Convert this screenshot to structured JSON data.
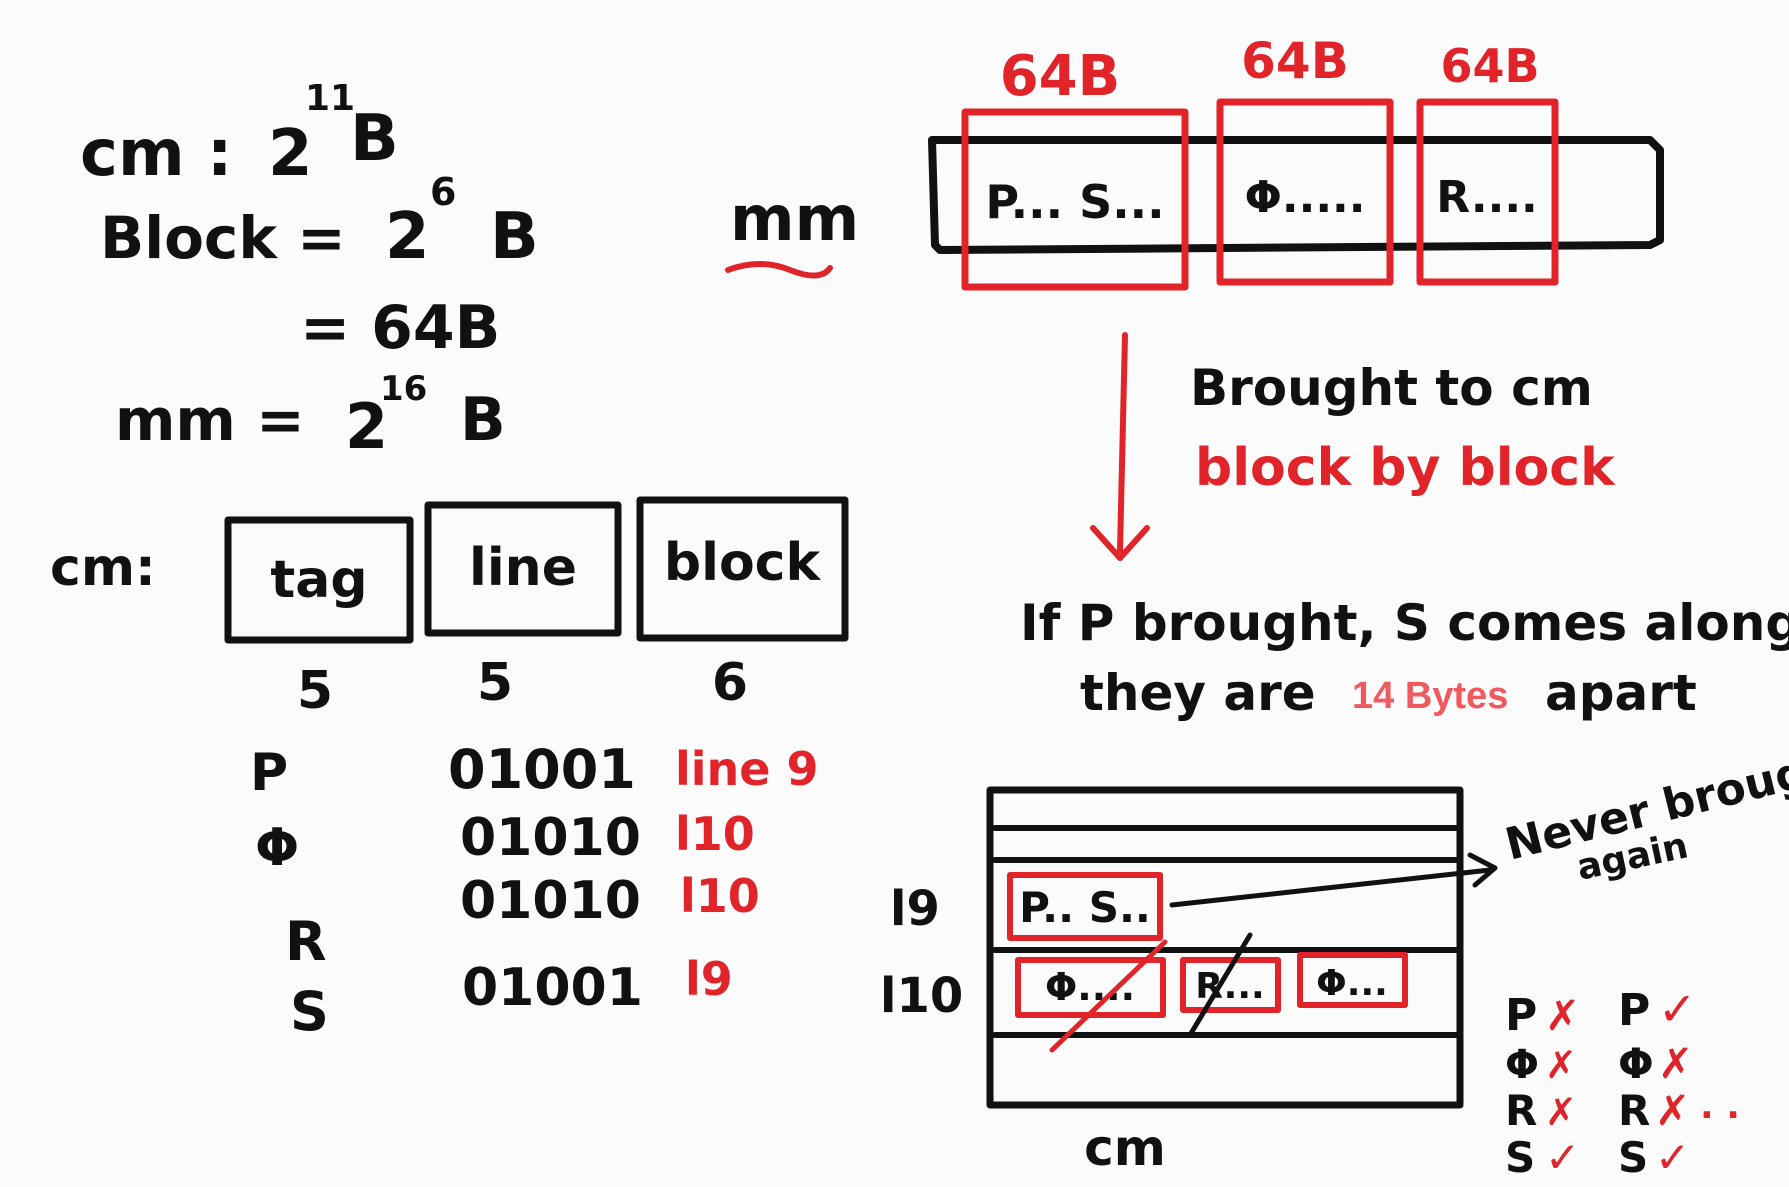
{
  "left_equations": {
    "cm": {
      "label": "cm :",
      "base": "2",
      "exp": "11",
      "unit": "B"
    },
    "block": {
      "label": "Block =",
      "base": "2",
      "exp": "6",
      "unit": "B",
      "eq2": "= 64B"
    },
    "mm": {
      "label": "mm =",
      "base": "2",
      "exp": "16",
      "unit": "B"
    }
  },
  "address_format": {
    "label": "cm:",
    "fields": [
      {
        "name": "tag",
        "bits": "5"
      },
      {
        "name": "line",
        "bits": "5"
      },
      {
        "name": "block",
        "bits": "6"
      }
    ]
  },
  "mapping_rows": [
    {
      "symbol": "P",
      "bits": "01001",
      "line": "line 9"
    },
    {
      "symbol": "Φ",
      "bits": "01010",
      "line": "l10"
    },
    {
      "symbol": "R",
      "bits": "01010",
      "line": "l10"
    },
    {
      "symbol": "S",
      "bits": "01001",
      "line": "l9"
    }
  ],
  "main_memory": {
    "label": "mm",
    "block_size_labels": [
      "64B",
      "64B",
      "64B"
    ],
    "blocks": [
      "P... S...",
      "Φ.....",
      "R...."
    ]
  },
  "notes": {
    "brought_line1": "Brought to cm",
    "brought_line2": "block by block",
    "if_line1": "If P brought, S comes along",
    "if_line2_pre": "they are",
    "if_line2_highlight": "14 Bytes",
    "if_line2_post": "apart"
  },
  "cache_diagram": {
    "label": "cm",
    "line9_label": "l9",
    "line10_label": "l10",
    "line9_block": "P.. S..",
    "line10_blocks": [
      "Φ....",
      "R...",
      "Φ..."
    ],
    "never_note_1": "Never brought",
    "never_note_2": "again"
  },
  "hit_miss_table": {
    "col1": [
      {
        "symbol": "P",
        "mark": "✗"
      },
      {
        "symbol": "Φ",
        "mark": "✗"
      },
      {
        "symbol": "R",
        "mark": "✗"
      },
      {
        "symbol": "S",
        "mark": "✓"
      }
    ],
    "col2": [
      {
        "symbol": "P",
        "mark": "✓"
      },
      {
        "symbol": "Φ",
        "mark": "✗"
      },
      {
        "symbol": "R",
        "mark": "✗"
      },
      {
        "symbol": "S",
        "mark": "✓"
      }
    ],
    "ellipsis": ". ."
  },
  "colors": {
    "ink": "#111111",
    "red": "#e0242a",
    "highlight": "#f05a5f",
    "paper": "#fbfbfb"
  }
}
